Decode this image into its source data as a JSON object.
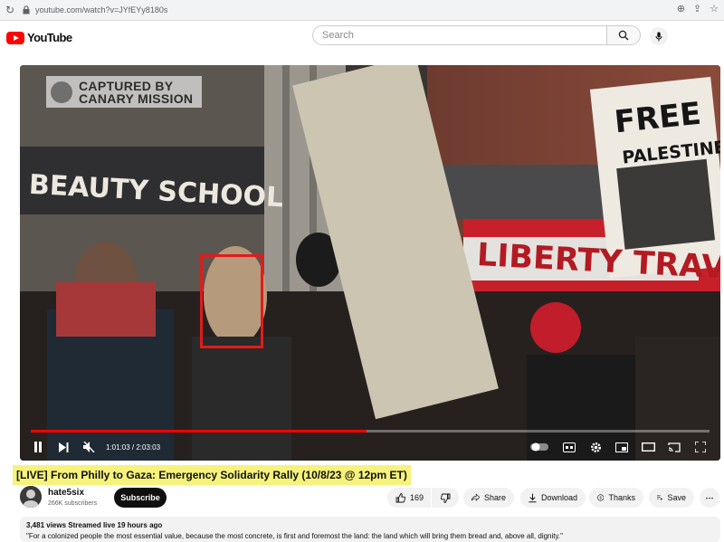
{
  "browser": {
    "url": "youtube.com/watch?v=JYfEYy8180s"
  },
  "header": {
    "logo_text": "YouTube",
    "search_placeholder": "Search"
  },
  "video": {
    "watermark": [
      "CAPTURED BY",
      "CANARY MISSION"
    ],
    "scene_text": {
      "store_sign": "BEAUTY SCHOOL",
      "banner": "LIBERTY TRAVE",
      "placard": [
        "FREE",
        "PALESTINE"
      ]
    },
    "time_display": "1:01:03 / 2:03:03",
    "progress_fraction": 0.495
  },
  "title": "[LIVE] From Philly to Gaza: Emergency Solidarity Rally (10/8/23 @ 12pm ET)",
  "channel": {
    "name": "hate5six",
    "subscribers": "266K subscribers",
    "subscribe_label": "Subscribe"
  },
  "actions": {
    "likes": "169",
    "share": "Share",
    "download": "Download",
    "thanks": "Thanks",
    "save": "Save"
  },
  "description": {
    "meta": "3,481 views  Streamed live 19 hours ago",
    "first_line": "\"For a colonized people the most essential value, because the most concrete, is first and foremost the land: the land which will bring them bread and, above all, dignity.\""
  },
  "colors": {
    "brand_red": "#ff0000",
    "title_highlight": "#f6f27b",
    "face_box": "#e11b1b"
  }
}
